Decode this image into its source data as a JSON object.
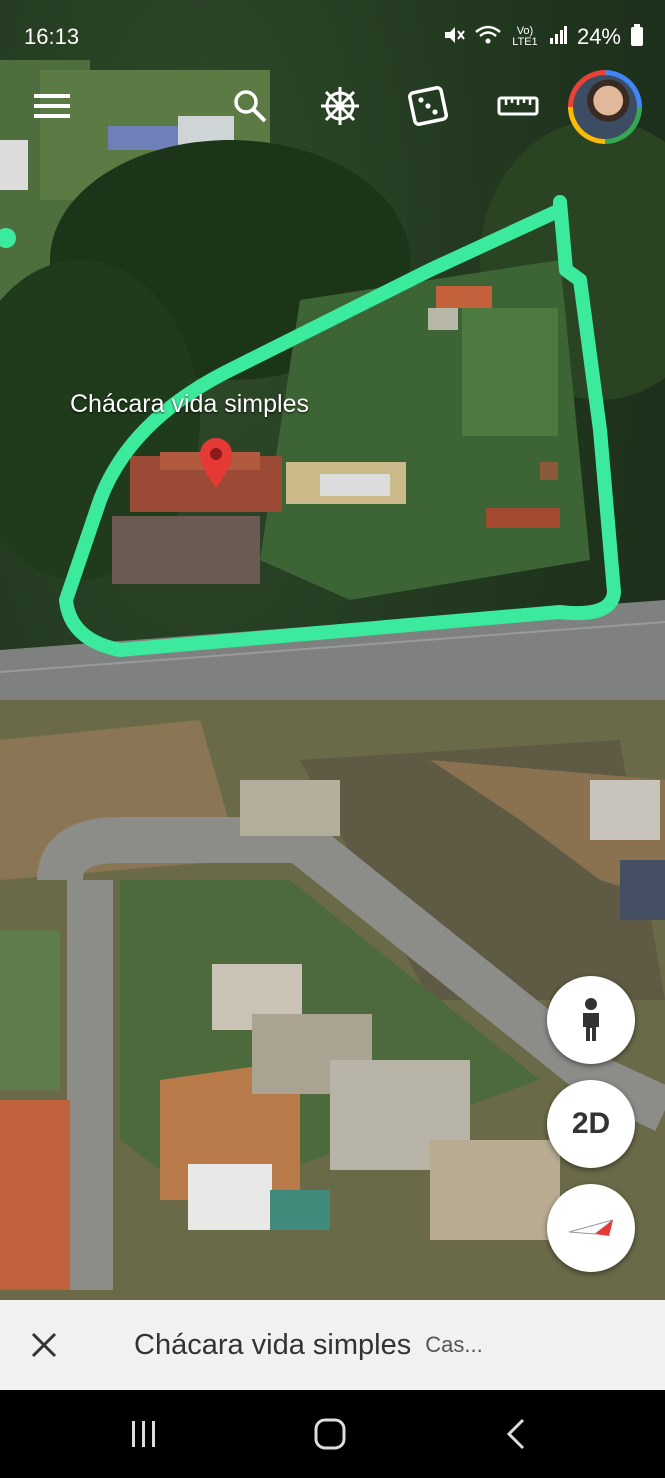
{
  "status_bar": {
    "time": "16:13",
    "network_label": "Vo) LTE1",
    "battery": "24%"
  },
  "toolbar": {
    "items": [
      "menu-icon",
      "search-icon",
      "voyager-wheel-icon",
      "dice-icon",
      "ruler-icon",
      "account-avatar"
    ]
  },
  "map": {
    "place_label": "Chácara vida simples",
    "marker_color": "#e53935",
    "outline_color": "#3bea9c"
  },
  "controls": {
    "view_mode_label": "2D"
  },
  "bottom_card": {
    "title": "Chácara vida simples",
    "subtitle": "Cas..."
  }
}
